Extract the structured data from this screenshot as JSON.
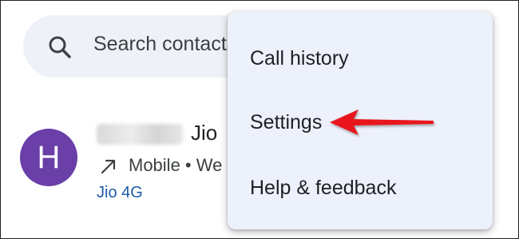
{
  "search": {
    "placeholder": "Search contacts"
  },
  "contact": {
    "avatar_letter": "H",
    "carrier": "Jio",
    "detail": "Mobile • We",
    "network": "Jio 4G"
  },
  "menu": {
    "items": [
      {
        "label": "Call history"
      },
      {
        "label": "Settings"
      },
      {
        "label": "Help & feedback"
      }
    ]
  },
  "colors": {
    "avatar": "#6a3fa8",
    "menu_background": "#edf1fb",
    "search_background": "#eef2f8",
    "network_text": "#1a5aa6",
    "annotation_arrow": "#e8141b"
  },
  "icons": {
    "search": "search-icon",
    "call_direction": "call-made-icon",
    "annotation": "red-arrow-icon"
  }
}
